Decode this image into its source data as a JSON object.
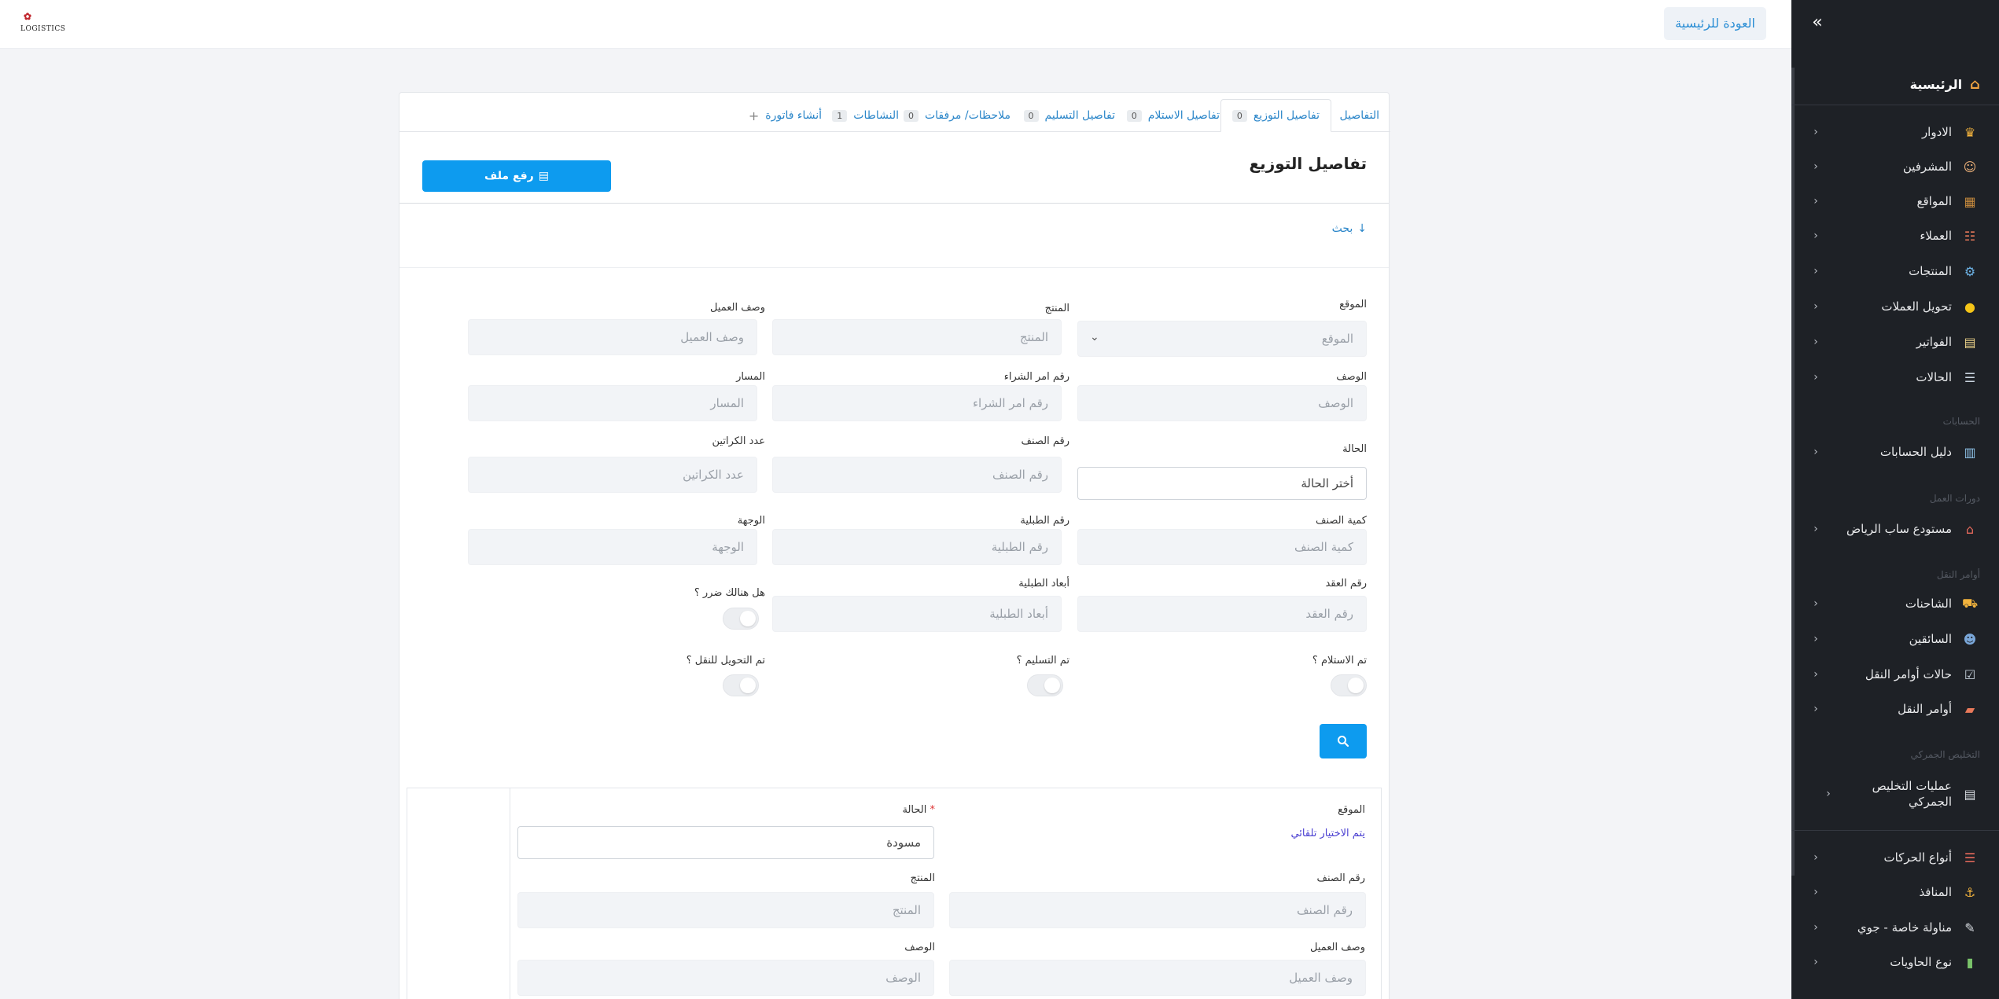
{
  "header": {
    "logo_text": "LOGISTICS",
    "home_button": "العودة للرئيسية"
  },
  "sidebar": {
    "home": "الرئيسية",
    "items": [
      {
        "label": "الادوار",
        "icon": "roles-icon"
      },
      {
        "label": "المشرفين",
        "icon": "supervisors-icon"
      },
      {
        "label": "المواقع",
        "icon": "sites-icon"
      },
      {
        "label": "العملاء",
        "icon": "clients-icon"
      },
      {
        "label": "المنتجات",
        "icon": "products-icon"
      },
      {
        "label": "تحويل العملات",
        "icon": "coins-icon"
      },
      {
        "label": "الفواتير",
        "icon": "invoices-icon"
      },
      {
        "label": "الحالات",
        "icon": "statuses-icon"
      }
    ],
    "section_accounts": "الحسابات",
    "accounts_item": "دليل الحسابات",
    "section_work_cycles": "دورات العمل",
    "work_cycles_item": "مستودع ساب الرياض",
    "section_transport": "أوامر النقل",
    "transport_items": [
      {
        "label": "الشاحنات",
        "icon": "truck-icon"
      },
      {
        "label": "السائقين",
        "icon": "driver-icon"
      },
      {
        "label": "حالات أوامر النقل",
        "icon": "checklist-icon"
      },
      {
        "label": "أوامر النقل",
        "icon": "orders-icon"
      }
    ],
    "section_customs": "التخليص الجمركي",
    "customs_item": "عمليات التخليص الجمركي",
    "bottom_items": [
      {
        "label": "أنواع الحركات",
        "icon": "movements-icon"
      },
      {
        "label": "المنافذ",
        "icon": "ports-icon"
      },
      {
        "label": "مناولة خاصة - جوي",
        "icon": "air-handling-icon"
      },
      {
        "label": "نوع الحاويات",
        "icon": "containers-icon"
      }
    ]
  },
  "tabs": [
    {
      "label": "التفاصيل",
      "count": ""
    },
    {
      "label": "تفاصيل التوزيع",
      "count": "0"
    },
    {
      "label": "تفاصيل الاستلام",
      "count": "0"
    },
    {
      "label": "تفاصيل التسليم",
      "count": "0"
    },
    {
      "label": "ملاحظات/ مرفقات",
      "count": "0"
    },
    {
      "label": "النشاطات",
      "count": "1"
    },
    {
      "label": "أنشاء فاتورة",
      "count": ""
    }
  ],
  "main": {
    "title": "تفاصيل التوزيع",
    "upload_button": "رفع ملف",
    "search_toggle": "بحث"
  },
  "filters": {
    "site": {
      "label": "الموقع",
      "placeholder": "الموقع"
    },
    "product": {
      "label": "المنتج",
      "placeholder": "المنتج"
    },
    "client_desc": {
      "label": "وصف العميل",
      "placeholder": "وصف العميل"
    },
    "description": {
      "label": "الوصف",
      "placeholder": "الوصف"
    },
    "po_number": {
      "label": "رقم امر الشراء",
      "placeholder": "رقم امر الشراء"
    },
    "route": {
      "label": "المسار",
      "placeholder": "المسار"
    },
    "status": {
      "label": "الحالة",
      "value": "أختر الحالة"
    },
    "item_number": {
      "label": "رقم الصنف",
      "placeholder": "رقم الصنف"
    },
    "cartons": {
      "label": "عدد الكراتين",
      "placeholder": "عدد الكراتين"
    },
    "item_qty": {
      "label": "كمية الصنف",
      "placeholder": "كمية الصنف"
    },
    "pallet_number": {
      "label": "رقم الطبلية",
      "placeholder": "رقم الطبلية"
    },
    "destination": {
      "label": "الوجهة",
      "placeholder": "الوجهة"
    },
    "contract_number": {
      "label": "رقم العقد",
      "placeholder": "رقم العقد"
    },
    "pallet_dims": {
      "label": "أبعاد الطبلية",
      "placeholder": "أبعاد الطبلية"
    },
    "damage": {
      "label": "هل هنالك ضرر ؟"
    },
    "received": {
      "label": "تم الاستلام ؟"
    },
    "delivered": {
      "label": "تم التسليم ؟"
    },
    "transferred": {
      "label": "تم التحويل للنقل ؟"
    }
  },
  "subform": {
    "site_label": "الموقع",
    "site_auto": "يتم الاختيار تلقائي",
    "status_label": "الحالة",
    "status_required": "*",
    "status_value": "مسودة",
    "item_number": {
      "label": "رقم الصنف",
      "placeholder": "رقم الصنف"
    },
    "product": {
      "label": "المنتج",
      "placeholder": "المنتج"
    },
    "client_desc": {
      "label": "وصف العميل",
      "placeholder": "وصف العميل"
    },
    "description": {
      "label": "الوصف",
      "placeholder": "الوصف"
    }
  },
  "colors": {
    "primary": "#0d9bef",
    "link": "#2b86c9",
    "sidebar_bg": "#1e2126"
  }
}
